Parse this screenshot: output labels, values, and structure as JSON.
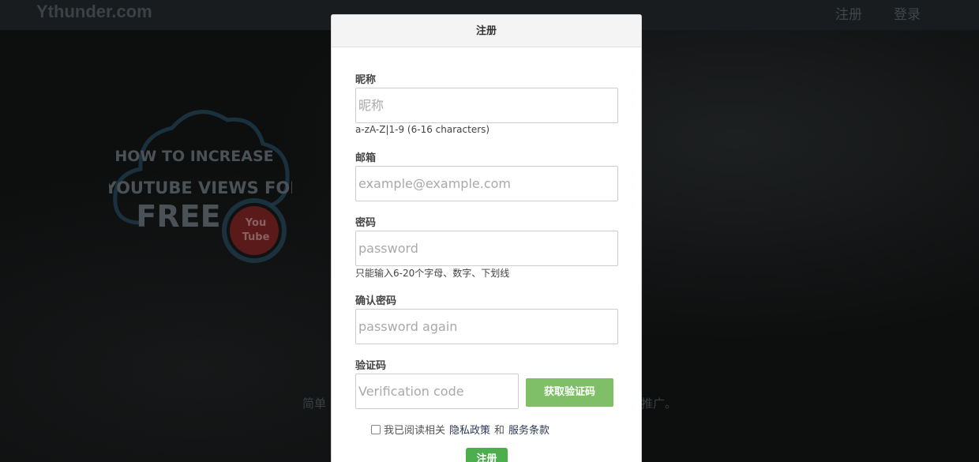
{
  "page": {
    "brand": "Ythunder.com",
    "nav": {
      "register": "注册",
      "login": "登录"
    },
    "promo": {
      "line1": "HOW TO INCREASE",
      "line2": "YOUTUBE VIEWS FOR",
      "line3": "FREE",
      "badge_top": "You",
      "badge_bottom": "Tube"
    },
    "tagline_start": "简单",
    "tagline_end": "推广。"
  },
  "modal": {
    "title": "注册",
    "nickname": {
      "label": "昵称",
      "placeholder": "昵称",
      "hint": "a-zA-Z|1-9 (6-16 characters)"
    },
    "email": {
      "label": "邮箱",
      "placeholder": "example@example.com"
    },
    "password": {
      "label": "密码",
      "placeholder": "password",
      "hint": "只能输入6-20个字母、数字、下划线"
    },
    "confirm": {
      "label": "确认密码",
      "placeholder": "password again"
    },
    "code": {
      "label": "验证码",
      "placeholder": "Verification code",
      "button": "获取验证码"
    },
    "agreement": {
      "text": "我已阅读相关",
      "privacy": "隐私政策",
      "and": "和",
      "terms": "服务条款"
    },
    "submit": "注册"
  },
  "colors": {
    "code_button": "#7fbf67",
    "submit_button": "#4cae4c",
    "overlay_bg": "#0d0e0e"
  }
}
